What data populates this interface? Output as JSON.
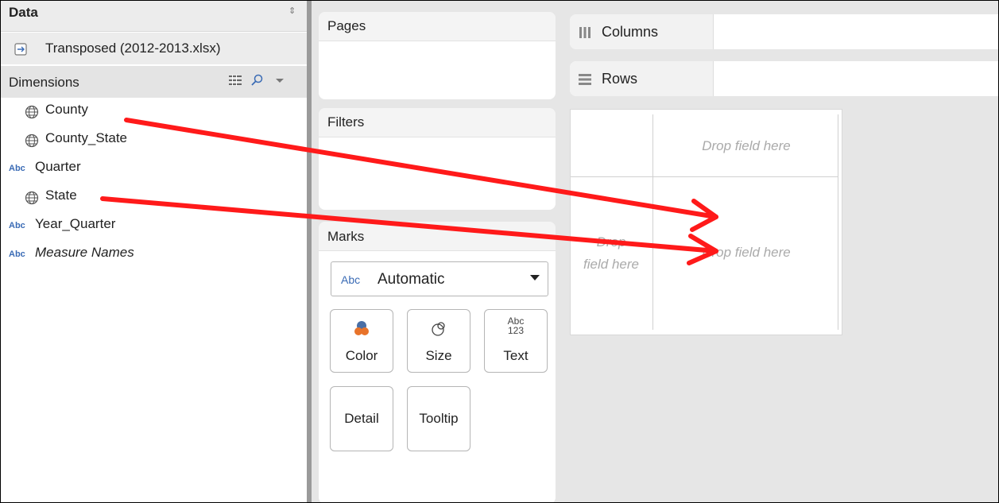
{
  "data_pane": {
    "title": "Data",
    "source": "Transposed (2012-2013.xlsx)",
    "dimensions_label": "Dimensions",
    "fields": [
      {
        "name": "County",
        "icon": "globe-icon"
      },
      {
        "name": "County_State",
        "icon": "globe-icon"
      },
      {
        "name": "Quarter",
        "icon": "abc",
        "badge": "Abc"
      },
      {
        "name": "State",
        "icon": "globe-icon"
      },
      {
        "name": "Year_Quarter",
        "icon": "abc",
        "badge": "Abc"
      },
      {
        "name": "Measure Names",
        "icon": "abc",
        "badge": "Abc",
        "italic": true
      }
    ]
  },
  "cards": {
    "pages": "Pages",
    "filters": "Filters",
    "marks": "Marks"
  },
  "marks": {
    "type_badge": "Abc",
    "type_value": "Automatic",
    "buttons": {
      "color": "Color",
      "size": "Size",
      "text": "Text",
      "detail": "Detail",
      "tooltip": "Tooltip"
    },
    "text_icon_top": "Abc",
    "text_icon_bottom": "123"
  },
  "shelves": {
    "columns": "Columns",
    "rows": "Rows"
  },
  "view": {
    "drop_top": "Drop field here",
    "drop_left_1": "Drop",
    "drop_left_2": "field here",
    "drop_center": "Drop field here"
  },
  "annotation": {
    "arrow_color": "#ff1a1a"
  }
}
